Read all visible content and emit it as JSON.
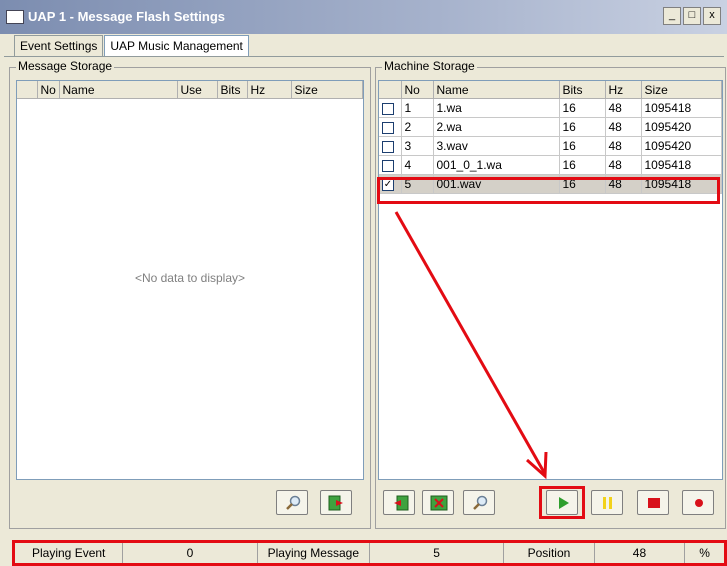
{
  "window": {
    "title": "UAP 1 - Message Flash Settings",
    "min": "_",
    "max": "□",
    "close": "x"
  },
  "tabs": [
    {
      "label": "Event Settings"
    },
    {
      "label": "UAP Music Management"
    }
  ],
  "message_storage": {
    "title": "Message Storage",
    "columns": [
      "No",
      "Name",
      "Use",
      "Bits",
      "Hz",
      "Size"
    ],
    "empty_text": "<No data to display>"
  },
  "machine_storage": {
    "title": "Machine Storage",
    "columns": [
      "No",
      "Name",
      "Bits",
      "Hz",
      "Size"
    ],
    "rows": [
      {
        "checked": false,
        "no": "1",
        "name": "1.wa",
        "bits": "16",
        "hz": "48",
        "size": "1095418"
      },
      {
        "checked": false,
        "no": "2",
        "name": "2.wa",
        "bits": "16",
        "hz": "48",
        "size": "1095420"
      },
      {
        "checked": false,
        "no": "3",
        "name": "3.wav",
        "bits": "16",
        "hz": "48",
        "size": "1095420"
      },
      {
        "checked": false,
        "no": "4",
        "name": "001_0_1.wa",
        "bits": "16",
        "hz": "48",
        "size": "1095418"
      },
      {
        "checked": true,
        "no": "5",
        "name": "001.wav",
        "bits": "16",
        "hz": "48",
        "size": "1095418"
      }
    ],
    "check_mark": "✓"
  },
  "status": {
    "playing_event_label": "Playing Event",
    "playing_event_value": "0",
    "playing_message_label": "Playing Message",
    "playing_message_value": "5",
    "position_label": "Position",
    "position_value": "48",
    "percent": "%"
  },
  "colors": {
    "annotation_red": "#E30B13",
    "play_green": "#2E9E2E",
    "stop_red": "#D8111B",
    "pause_yellow": "#F2D21B"
  }
}
